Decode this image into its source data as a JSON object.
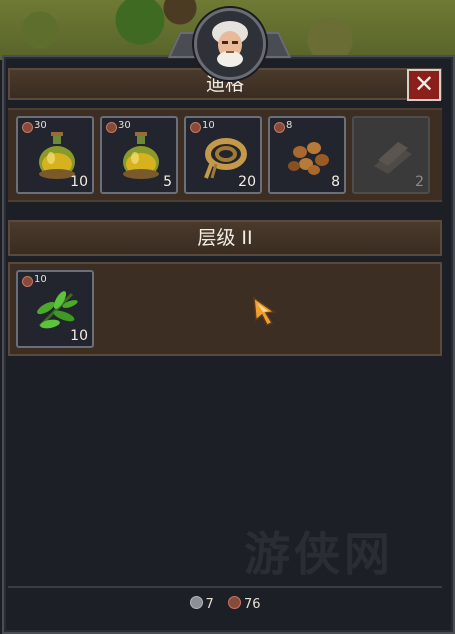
{
  "merchant": {
    "name": "迪格"
  },
  "close_label": "✕",
  "inventory": [
    {
      "item": "oil-flask",
      "price": "30",
      "qty": "10",
      "disabled": false
    },
    {
      "item": "oil-flask",
      "price": "30",
      "qty": "5",
      "disabled": false
    },
    {
      "item": "rope-coil",
      "price": "10",
      "qty": "20",
      "disabled": false
    },
    {
      "item": "nuts",
      "price": "8",
      "qty": "8",
      "disabled": false
    },
    {
      "item": "wood-planks",
      "price": "",
      "qty": "2",
      "disabled": true
    }
  ],
  "tier": {
    "label": "层级 II",
    "items": [
      {
        "item": "herb-leaves",
        "price": "10",
        "qty": "10"
      }
    ]
  },
  "currency": {
    "silver": "7",
    "copper": "76"
  },
  "watermark": "游侠网",
  "colors": {
    "panel": "#1d1f26",
    "header": "#3a2c21",
    "row": "#3d2e24",
    "close": "#8a1f1c",
    "slot_border": "#6b6f7a"
  }
}
